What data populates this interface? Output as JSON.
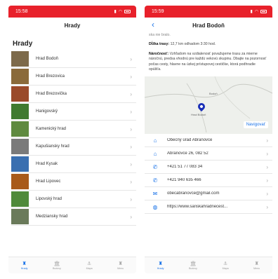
{
  "left": {
    "status_time": "15:58",
    "nav_title": "Hrady",
    "section_title": "Hrady",
    "castles": [
      {
        "name": "Hrad Bodoň",
        "color": "#7d6a4a"
      },
      {
        "name": "Hrad Brezovica",
        "color": "#8a6a3a"
      },
      {
        "name": "Hrad Brezovička",
        "color": "#9a4a2a"
      },
      {
        "name": "Hanigovský",
        "color": "#3f7a2f"
      },
      {
        "name": "Kamenický hrad",
        "color": "#5f8a3f"
      },
      {
        "name": "Kapušiansky hrad",
        "color": "#7a7a7a"
      },
      {
        "name": "Hrad Kysak",
        "color": "#3a6fb0"
      },
      {
        "name": "Hrad Lipovec",
        "color": "#a85a1a"
      },
      {
        "name": "Lipovský hrad",
        "color": "#4f8a3a"
      },
      {
        "name": "Medziansky hrad",
        "color": "#6a7a5a"
      }
    ],
    "tabs": [
      {
        "label": "Hrady",
        "icon": "castle-icon",
        "glyph": "♜",
        "active": true
      },
      {
        "label": "Budovy",
        "icon": "building-icon",
        "glyph": "🏛",
        "active": false
      },
      {
        "label": "Mapa",
        "icon": "map-icon",
        "glyph": "⚓",
        "active": false
      },
      {
        "label": "Menu",
        "icon": "menu-icon",
        "glyph": "♜",
        "active": false
      }
    ]
  },
  "right": {
    "status_time": "15:59",
    "nav_title": "Hrad Bodoň",
    "back_glyph": "‹",
    "intro_cut": "ska nie bralo.",
    "length_label": "Dĺžka trasy:",
    "length_value": "12,7 km odhadom 3:30 hod.",
    "difficulty_label": "Náročnosť:",
    "difficulty_value": "Vzhľadom na vzdialenosť považujeme trasu za mierne náročnú, predsa vhodnú pre každú vekovú skupinu. Dbajte na pozornosť počas cesty, hlavne na úzkej prístupovej cestičke, ktorá podhradie opúšťa.",
    "map": {
      "pin_label": "Hrad Bodoň",
      "top_label": "Bodoň",
      "navigate_label": "Navigovať"
    },
    "info": [
      {
        "icon": "home-icon",
        "glyph": "⌂",
        "text": "Obecný úrad Abranovce"
      },
      {
        "icon": "home-icon",
        "glyph": "⌂",
        "text": "Abranovce 26, 082 52"
      },
      {
        "icon": "phone-icon",
        "glyph": "✆",
        "text": "+421 51 77 083 34"
      },
      {
        "icon": "phone-icon",
        "glyph": "✆",
        "text": "+421 940 635 466"
      },
      {
        "icon": "mail-icon",
        "glyph": "✉",
        "text": "obecabranovce@gmail.com"
      },
      {
        "icon": "globe-icon",
        "glyph": "◍",
        "text": "https://www.sariskahradnecest..."
      }
    ],
    "tabs": [
      {
        "label": "Hrady",
        "icon": "castle-icon",
        "glyph": "♜",
        "active": true
      },
      {
        "label": "Budovy",
        "icon": "building-icon",
        "glyph": "🏛",
        "active": false
      },
      {
        "label": "Mapa",
        "icon": "map-icon",
        "glyph": "⚓",
        "active": false
      },
      {
        "label": "Menu",
        "icon": "menu-icon",
        "glyph": "♜",
        "active": false
      }
    ]
  },
  "colors": {
    "statusbar": "#e8212b",
    "accent": "#1a73e8",
    "pin": "#1a2fb8"
  }
}
